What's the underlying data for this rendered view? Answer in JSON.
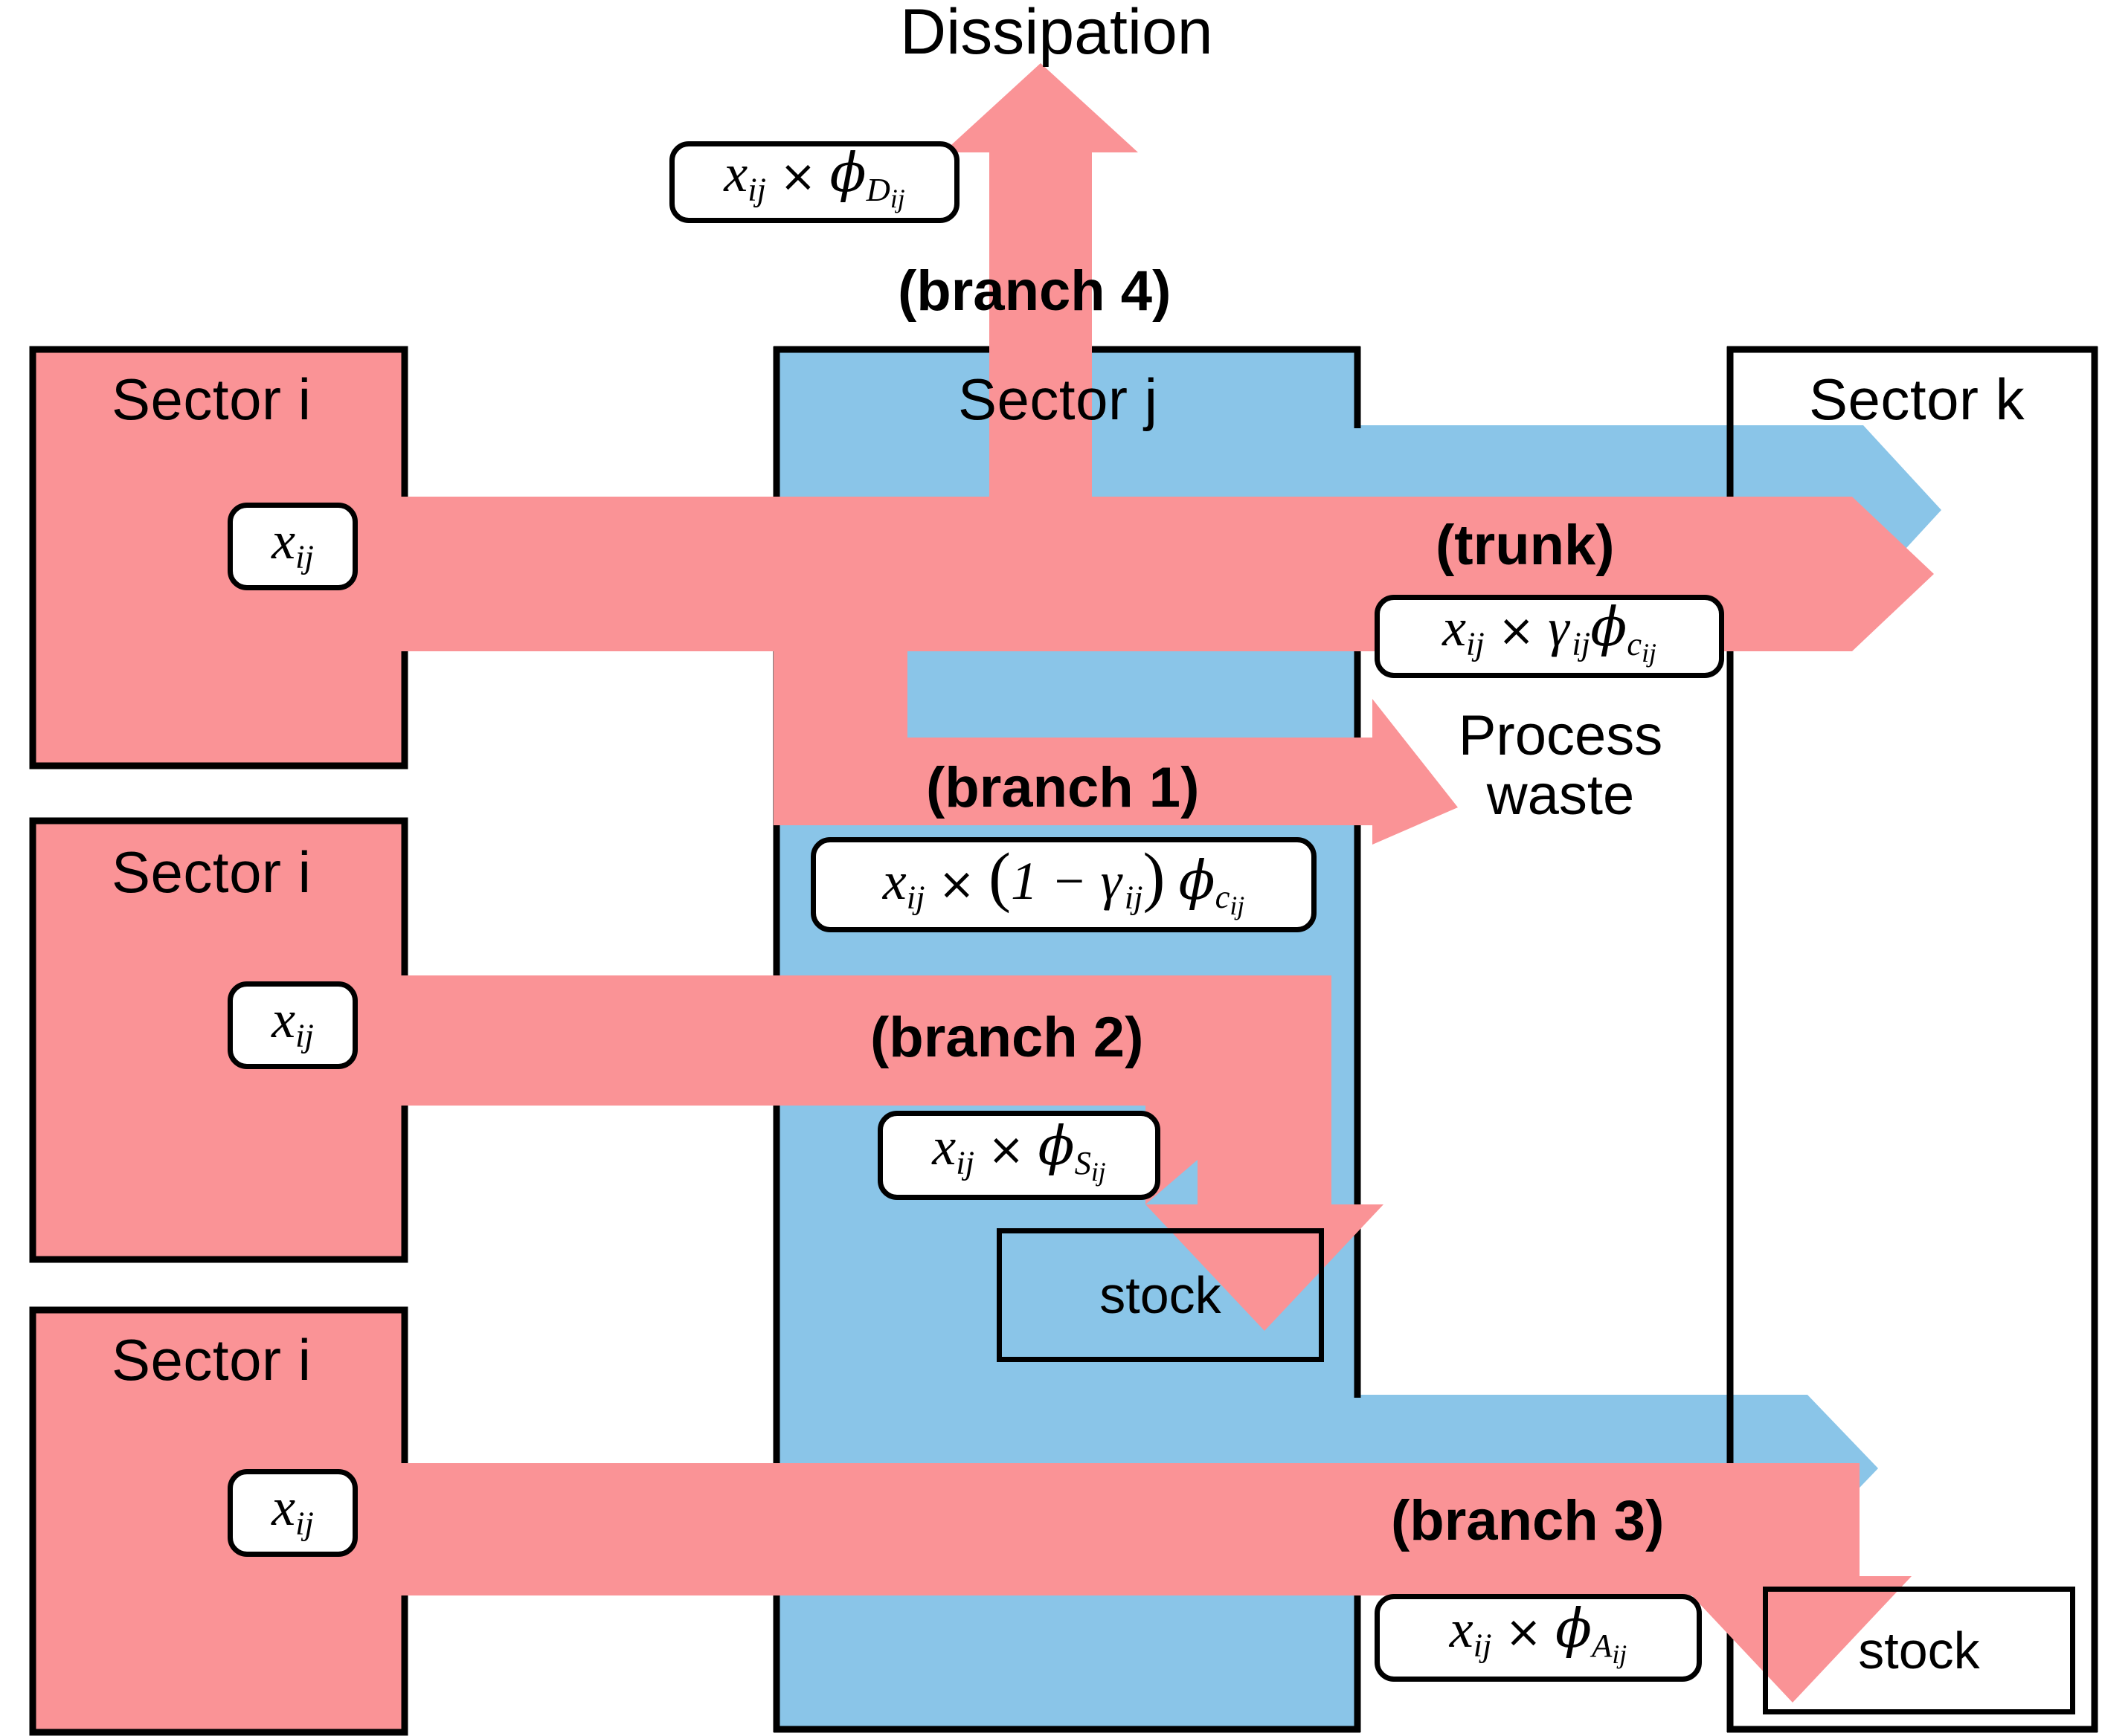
{
  "diagram": {
    "title_top": "Dissipation",
    "colors": {
      "flow_pink": "#FA9396",
      "sector_blue": "#8AC5E8",
      "outline_black": "#000000",
      "background_white": "#FFFFFF"
    },
    "sectors": {
      "source_label": "Sector i",
      "process_label": "Sector j",
      "destination_label": "Sector k"
    },
    "source_boxes": [
      {
        "label": "Sector i",
        "flow_value": "x_ij"
      },
      {
        "label": "Sector i",
        "flow_value": "x_ij"
      },
      {
        "label": "Sector i",
        "flow_value": "x_ij"
      }
    ],
    "flow_labels": {
      "trunk": "(trunk)",
      "branch1": "(branch 1)",
      "branch2": "(branch 2)",
      "branch3": "(branch 3)",
      "branch4": "(branch 4)"
    },
    "endpoints": {
      "dissipation": "Dissipation",
      "process_waste": "Process\nwaste",
      "process_waste_line1": "Process",
      "process_waste_line2": "waste",
      "stock_in_j": "stock",
      "stock_in_k": "stock"
    },
    "formulas": {
      "input_xij": "x_ij",
      "branch4_dissipation": "x_ij × φ_D_ij",
      "trunk_to_k": "x_ij × γ_ij φ_c_ij",
      "branch1_waste": "x_ij × (1 − γ_ij) φ_c_ij",
      "branch2_stock": "x_ij × φ_S_ij",
      "branch3_stock_k": "x_ij × φ_A_ij"
    },
    "geometry_note": "three pink Sector i source blocks on the left feed a blue Sector j process block; flows split into trunk plus branches 1-4"
  }
}
